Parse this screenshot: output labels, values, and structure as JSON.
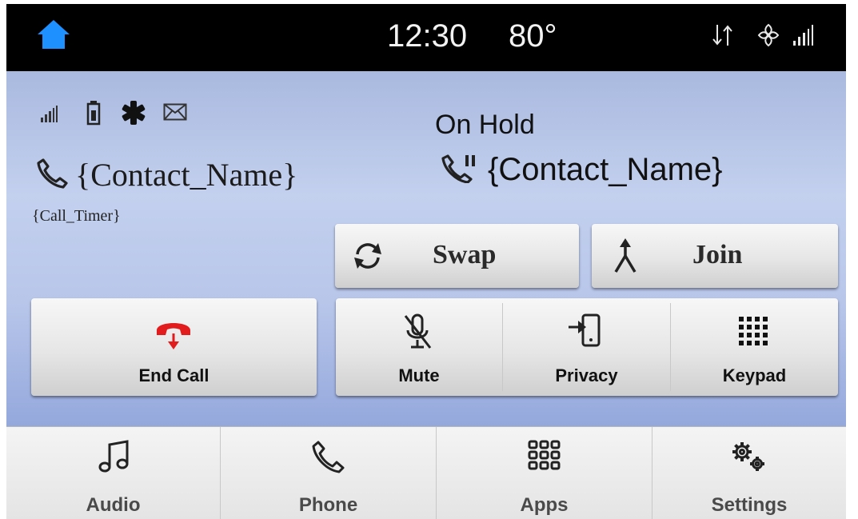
{
  "status_bar": {
    "clock": "12:30",
    "temperature": "80°",
    "icons": [
      "home-icon",
      "data-transfer-icon",
      "climate-fan-icon",
      "signal-icon"
    ]
  },
  "active_call": {
    "phone_status_icons": [
      "signal-bars-icon",
      "battery-icon",
      "bluetooth-icon",
      "message-icon"
    ],
    "contact_name": "{Contact_Name}",
    "call_timer": "{Call_Timer}"
  },
  "held_call": {
    "status": "On Hold",
    "contact_name": "{Contact_Name}"
  },
  "actions": {
    "swap": "Swap",
    "join": "Join",
    "end_call": "End Call",
    "mute": "Mute",
    "privacy": "Privacy",
    "keypad": "Keypad"
  },
  "bottom_nav": [
    {
      "label": "Audio",
      "icon": "music-note-icon"
    },
    {
      "label": "Phone",
      "icon": "phone-icon"
    },
    {
      "label": "Apps",
      "icon": "apps-grid-icon"
    },
    {
      "label": "Settings",
      "icon": "gears-icon"
    }
  ],
  "colors": {
    "top_bar": "#000000",
    "home_icon": "#1e90ff",
    "end_call_icon": "#e21c1c",
    "background_top": "#a9b9df",
    "background_bottom": "#94a8dc"
  }
}
